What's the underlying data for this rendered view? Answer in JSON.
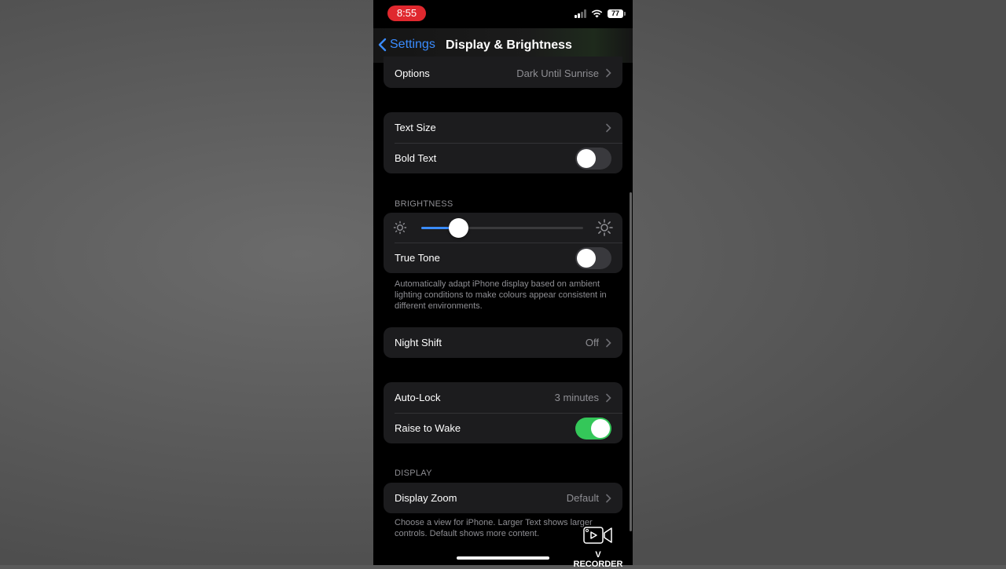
{
  "status_bar": {
    "time": "8:55",
    "battery": "77"
  },
  "nav": {
    "back_label": "Settings",
    "title": "Display & Brightness"
  },
  "appearance_options": {
    "label": "Options",
    "value": "Dark Until Sunrise"
  },
  "text_group": {
    "text_size_label": "Text Size",
    "bold_text_label": "Bold Text",
    "bold_text_on": false
  },
  "brightness": {
    "header": "BRIGHTNESS",
    "level_fraction": 0.23,
    "true_tone_label": "True Tone",
    "true_tone_on": false,
    "footer": "Automatically adapt iPhone display based on ambient lighting conditions to make colours appear consistent in different environments."
  },
  "night_shift": {
    "label": "Night Shift",
    "value": "Off"
  },
  "lock_group": {
    "auto_lock_label": "Auto-Lock",
    "auto_lock_value": "3 minutes",
    "raise_to_wake_label": "Raise to Wake",
    "raise_to_wake_on": true
  },
  "display": {
    "header": "DISPLAY",
    "zoom_label": "Display Zoom",
    "zoom_value": "Default",
    "footer": "Choose a view for iPhone. Larger Text shows larger controls. Default shows more content."
  },
  "watermark": {
    "text": "V RECORDER"
  },
  "colors": {
    "accent": "#3a8cff",
    "toggle_on": "#34c759",
    "time_pill": "#e0282e"
  }
}
